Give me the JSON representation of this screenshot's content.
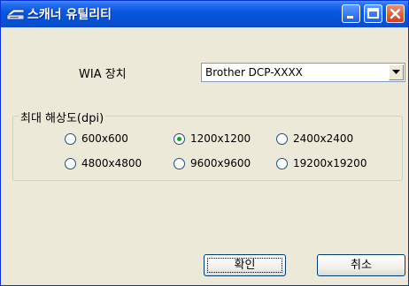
{
  "window": {
    "title": "스캐너 유틸리티"
  },
  "device": {
    "label": "WIA 장치",
    "selected": "Brother DCP-XXXX"
  },
  "resolution": {
    "group_label": "최대 해상도(dpi)",
    "options": [
      "600x600",
      "1200x1200",
      "2400x2400",
      "4800x4800",
      "9600x9600",
      "19200x19200"
    ],
    "selected": "1200x1200"
  },
  "buttons": {
    "ok": "확인",
    "cancel": "취소"
  },
  "colors": {
    "titlebar": "#0a58e0",
    "dialog_bg": "#ece9d8",
    "close": "#d4401c"
  }
}
